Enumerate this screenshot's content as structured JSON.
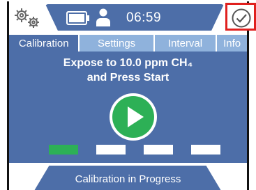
{
  "status": {
    "time": "06:59",
    "icons": [
      "gear-icon",
      "battery-icon",
      "person-icon",
      "check-icon"
    ],
    "accent_color": "#4d6ea8",
    "highlight_color": "#e0201e"
  },
  "tabs": [
    {
      "label": "Calibration",
      "active": true
    },
    {
      "label": "Settings",
      "active": false
    },
    {
      "label": "Interval",
      "active": false
    },
    {
      "label": "Info",
      "active": false
    }
  ],
  "main": {
    "prompt_line1": "Expose to 10.0 ppm CH₄",
    "prompt_line2": "and Press Start",
    "play_icon": "play-icon",
    "play_color": "#2db056",
    "progress": {
      "completed_steps": 1,
      "total_steps": 4
    }
  },
  "footer": {
    "status_text": "Calibration in Progress"
  }
}
